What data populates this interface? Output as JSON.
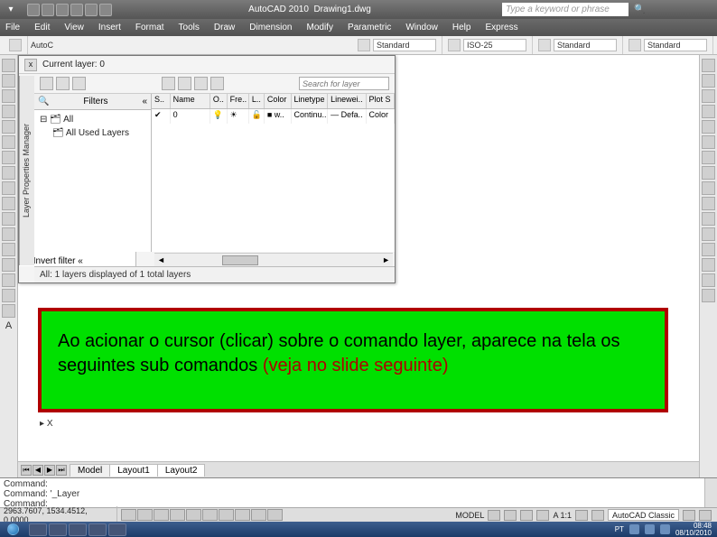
{
  "titlebar": {
    "app": "AutoCAD 2010",
    "doc": "Drawing1.dwg",
    "search_placeholder": "Type a keyword or phrase"
  },
  "menu": [
    "File",
    "Edit",
    "View",
    "Insert",
    "Format",
    "Tools",
    "Draw",
    "Dimension",
    "Modify",
    "Parametric",
    "Window",
    "Help",
    "Express"
  ],
  "ribbon": {
    "truncated": "AutoC",
    "style1": "Standard",
    "style2": "ISO-25",
    "style3": "Standard",
    "style4": "Standard"
  },
  "layer_panel": {
    "tab_label": "Layer Properties Manager",
    "current": "Current layer: 0",
    "search_placeholder": "Search for layer",
    "filters_header": "Filters",
    "filters_collapse": "«",
    "tree_root": "All",
    "tree_child": "All Used Layers",
    "invert_label": "Invert filter",
    "columns": [
      "S..",
      "Name",
      "O..",
      "Fre..",
      "L..",
      "Color",
      "Linetype",
      "Linewei..",
      "Plot S"
    ],
    "row": {
      "name": "0",
      "color": "w..",
      "linetype": "Continu..",
      "lineweight": "— Defa..",
      "plot": "Color"
    },
    "status": "All: 1 layers displayed of 1 total layers"
  },
  "annotation": {
    "line1": "Ao acionar o cursor (clicar) sobre o comando layer, aparece na tela os seguintes sub comandos ",
    "hl": "(veja no slide seguinte)"
  },
  "ucs": {
    "x": "X"
  },
  "tabs": {
    "items": [
      "Model",
      "Layout1",
      "Layout2"
    ]
  },
  "command": {
    "line1": "Command:",
    "line2": "Command: '_Layer",
    "line3": "Command:"
  },
  "status": {
    "coord": "2963.7607, 1534.4512, 0.0000",
    "model": "MODEL",
    "scale": "A 1:1",
    "workspace": "AutoCAD Classic"
  },
  "taskbar": {
    "lang": "PT",
    "time": "08:48",
    "date": "08/10/2010"
  }
}
